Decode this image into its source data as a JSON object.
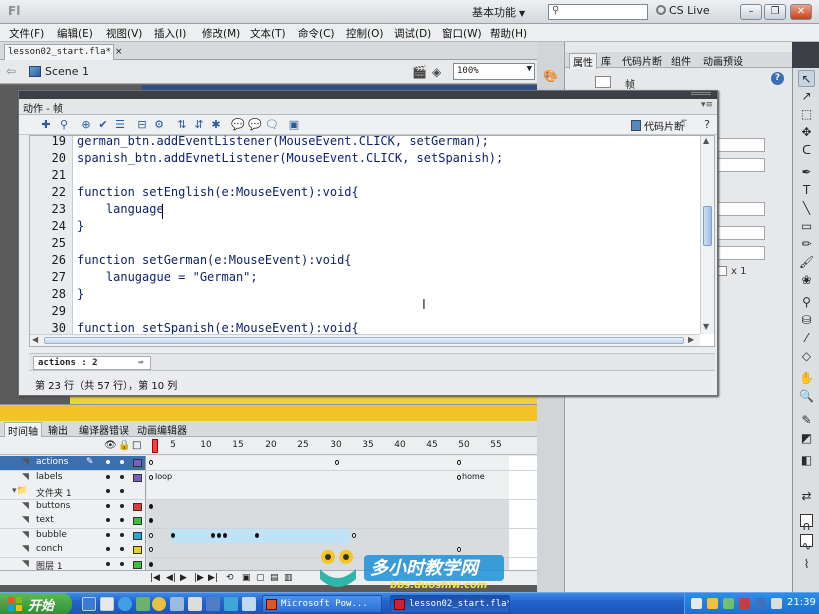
{
  "window": {
    "logo": "Fl",
    "workspace": "基本功能",
    "search_placeholder": "",
    "cs_live": "CS Live",
    "minimize": "–",
    "maximize": "❐",
    "close": "✕"
  },
  "menu": [
    "文件(F)",
    "编辑(E)",
    "视图(V)",
    "插入(I)",
    "修改(M)",
    "文本(T)",
    "命令(C)",
    "控制(O)",
    "调试(D)",
    "窗口(W)",
    "帮助(H)"
  ],
  "document": {
    "tab_label": "lesson02_start.fla*",
    "tab_close": "×",
    "scene_label": "Scene 1",
    "zoom": "100%"
  },
  "actions_panel": {
    "title": "动作 - 帧",
    "code_snippets_label": "代码片断",
    "code_lines": [
      {
        "num": "19",
        "text": "german_btn.addEventListener(MouseEvent.CLICK, setGerman);"
      },
      {
        "num": "20",
        "text": "spanish_btn.addEvnetListener(MouseEvent.CLICK, setSpanish);"
      },
      {
        "num": "21",
        "text": ""
      },
      {
        "num": "22",
        "text": "function setEnglish(e:MouseEvent):void{"
      },
      {
        "num": "23",
        "text": "    language"
      },
      {
        "num": "24",
        "text": "}"
      },
      {
        "num": "25",
        "text": ""
      },
      {
        "num": "26",
        "text": "function setGerman(e:MouseEvent):void{"
      },
      {
        "num": "27",
        "text": "    lanugague = \"German\";"
      },
      {
        "num": "28",
        "text": "}"
      },
      {
        "num": "29",
        "text": ""
      },
      {
        "num": "30",
        "text": "function setSpanish(e:MouseEvent):void{"
      },
      {
        "num": "31",
        "text": ""
      }
    ],
    "script_tab": "actions : 2",
    "status": "第 23 行（共 57 行），第 10 列"
  },
  "properties": {
    "tabs": [
      "属性",
      "库",
      "代码片断",
      "组件",
      "动画预设"
    ],
    "frame_label": "帧",
    "x_value": "x 1",
    "help": "?"
  },
  "timeline": {
    "tabs": [
      "时间轴",
      "输出",
      "编译器错误",
      "动画编辑器"
    ],
    "frame_numbers": [
      "5",
      "10",
      "15",
      "20",
      "25",
      "30",
      "35",
      "40",
      "45",
      "50",
      "55"
    ],
    "layers": [
      {
        "name": "actions",
        "type": "layer",
        "color": "#7b5cc8"
      },
      {
        "name": "labels",
        "type": "layer",
        "color": "#7b5cc8"
      },
      {
        "name": "文件夹 1",
        "type": "folder",
        "color": ""
      },
      {
        "name": "buttons",
        "type": "layer",
        "color": "#e23a3a"
      },
      {
        "name": "text",
        "type": "layer",
        "color": "#3ac23a"
      },
      {
        "name": "bubble",
        "type": "layer",
        "color": "#2aa5d6"
      },
      {
        "name": "conch",
        "type": "layer",
        "color": "#e8d02a"
      },
      {
        "name": "图层 1",
        "type": "layer",
        "color": "#3ac23a"
      }
    ],
    "frame_labels": {
      "loop": "loop",
      "home": "home"
    }
  },
  "taskbar": {
    "start": "开始",
    "tasks": [
      {
        "label": "Microsoft Pow...",
        "active": false
      },
      {
        "label": "lesson02_start.fla*",
        "active": true
      }
    ],
    "clock": "21:39"
  },
  "watermark": {
    "text": "多小时教学网",
    "url": "bbs.duoshiw.com"
  },
  "colors": {
    "accent": "#3b6fb0",
    "code_text": "#0b1f6e",
    "taskbar": "#2363cc"
  }
}
